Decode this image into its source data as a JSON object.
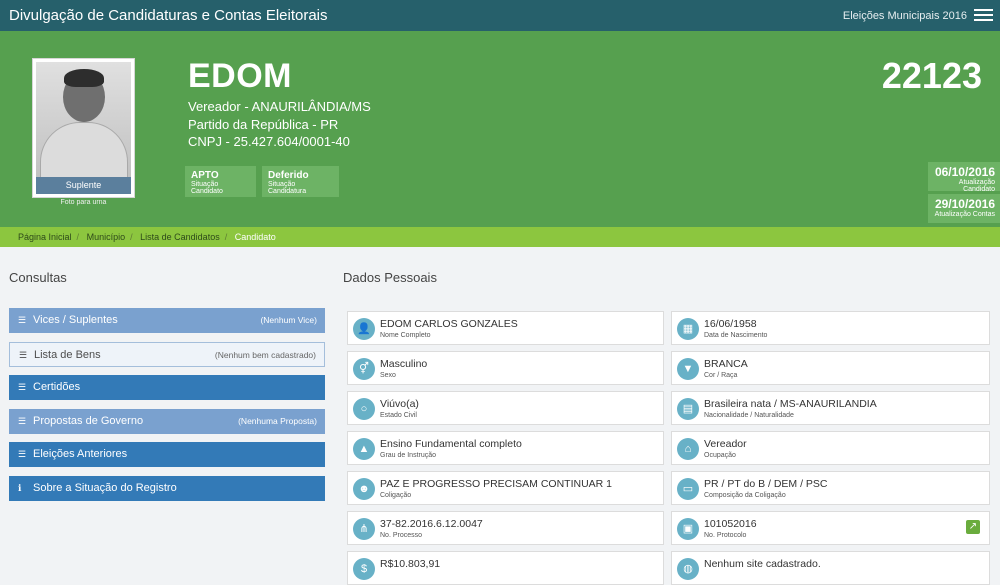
{
  "header": {
    "title": "Divulgação de Candidaturas e Contas Eleitorais",
    "election": "Eleições Municipais 2016"
  },
  "candidate": {
    "name": "EDOM",
    "number": "22123",
    "role": "Vereador - ANAURILÂNDIA/MS",
    "party": "Partido da República - PR",
    "cnpj": "CNPJ - 25.427.604/0001-40",
    "photo_caption": "Suplente",
    "photo_note": "Foto para urna",
    "status_candidate": {
      "value": "APTO",
      "label": "Situação Candidato"
    },
    "status_candidacy": {
      "value": "Deferido",
      "label": "Situação Candidatura"
    },
    "update_candidate": {
      "date": "06/10/2016",
      "label": "Atualização Candidato"
    },
    "update_accounts": {
      "date": "29/10/2016",
      "label": "Atualização Contas"
    }
  },
  "breadcrumb": [
    "Página Inicial",
    "Município",
    "Lista de Candidatos",
    "Candidato"
  ],
  "consultas": {
    "title": "Consultas",
    "items": [
      {
        "label": "Vices / Suplentes",
        "badge": "(Nenhum Vice)"
      },
      {
        "label": "Lista de Bens",
        "badge": "(Nenhum bem cadastrado)"
      },
      {
        "label": "Certidões",
        "badge": ""
      },
      {
        "label": "Propostas de Governo",
        "badge": "(Nenhuma Proposta)"
      },
      {
        "label": "Eleições Anteriores",
        "badge": ""
      },
      {
        "label": "Sobre a Situação do Registro",
        "badge": ""
      }
    ]
  },
  "dados": {
    "title": "Dados Pessoais",
    "fields": [
      {
        "value": "EDOM CARLOS GONZALES",
        "label": "Nome Completo",
        "icon": "user-icon"
      },
      {
        "value": "16/06/1958",
        "label": "Data de Nascimento",
        "icon": "calendar-icon"
      },
      {
        "value": "Masculino",
        "label": "Sexo",
        "icon": "gender-icon"
      },
      {
        "value": "BRANCA",
        "label": "Cor / Raça",
        "icon": "shirt-icon"
      },
      {
        "value": "Viúvo(a)",
        "label": "Estado Civil",
        "icon": "ring-icon"
      },
      {
        "value": "Brasileira nata / MS-ANAURILANDIA",
        "label": "Nacionalidade / Naturalidade",
        "icon": "map-icon"
      },
      {
        "value": "Ensino Fundamental completo",
        "label": "Grau de Instrução",
        "icon": "graduation-icon"
      },
      {
        "value": "Vereador",
        "label": "Ocupação",
        "icon": "institution-icon"
      },
      {
        "value": "PAZ E PROGRESSO PRECISAM CONTINUAR 1",
        "label": "Coligação",
        "icon": "group-icon"
      },
      {
        "value": "PR / PT do B / DEM / PSC",
        "label": "Composição da Coligação",
        "icon": "folder-icon"
      },
      {
        "value": "37-82.2016.6.12.0047",
        "label": "No. Processo",
        "icon": "sitemap-icon"
      },
      {
        "value": "101052016",
        "label": "No. Protocolo",
        "icon": "briefcase-icon"
      },
      {
        "value": "R$10.803,91",
        "label": "",
        "icon": "dollar-icon"
      },
      {
        "value": "Nenhum site cadastrado.",
        "label": "",
        "icon": "globe-icon"
      }
    ]
  }
}
